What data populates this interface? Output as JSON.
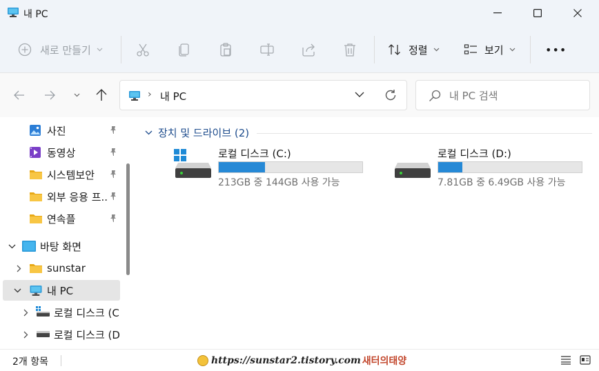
{
  "window": {
    "title": "내 PC",
    "minimize": "minimize",
    "maximize": "maximize",
    "close": "close"
  },
  "toolbar": {
    "new_label": "새로 만들기",
    "sort_label": "정렬",
    "view_label": "보기",
    "more_label": "•••",
    "icons": [
      "cut-icon",
      "copy-icon",
      "paste-icon",
      "rename-icon",
      "share-icon",
      "delete-icon"
    ]
  },
  "address": {
    "separator": "›",
    "crumb": "내 PC"
  },
  "search": {
    "placeholder": "내 PC 검색"
  },
  "sidebar": {
    "quick_access": [
      {
        "label": "사진",
        "icon": "photos-icon"
      },
      {
        "label": "동영상",
        "icon": "videos-icon"
      },
      {
        "label": "시스템보안",
        "icon": "folder-icon"
      },
      {
        "label": "외부 응용 프...",
        "icon": "folder-icon"
      },
      {
        "label": "연속플",
        "icon": "folder-icon"
      }
    ],
    "desktop": "바탕 화면",
    "sunstar": "sunstar",
    "this_pc": "내 PC",
    "drive_c": "로컬 디스크 (C",
    "drive_d": "로컬 디스크 (D"
  },
  "content": {
    "section_title": "장치 및 드라이브 (2)",
    "drives": [
      {
        "name": "로컬 디스크 (C:)",
        "free_text": "213GB 중 144GB 사용 가능",
        "used_fraction": 0.32
      },
      {
        "name": "로컬 디스크 (D:)",
        "free_text": "7.81GB 중 6.49GB 사용 가능",
        "used_fraction": 0.17
      }
    ]
  },
  "status": {
    "item_count": "2개 항목",
    "watermark_url": "https://sunstar2.tistory.com",
    "watermark_brand": "새터의태양"
  },
  "colors": {
    "accent": "#2689d6",
    "section_header": "#1c4b8c",
    "chrome": "#f0f4f9"
  }
}
